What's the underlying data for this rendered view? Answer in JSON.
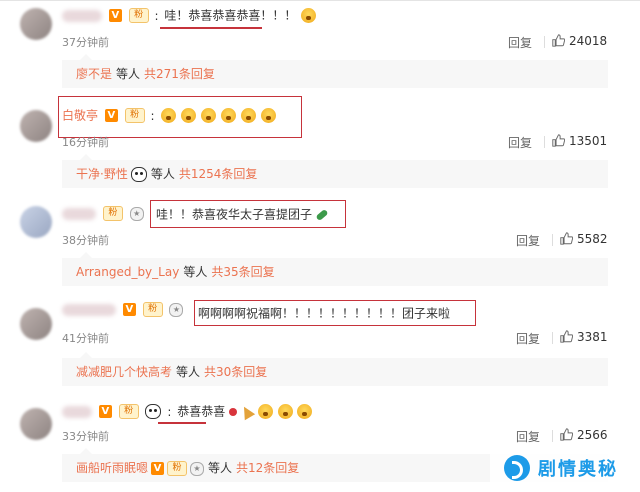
{
  "comments": [
    {
      "username": "",
      "badges": [
        "V",
        "fan"
      ],
      "text": "哇！恭喜恭喜恭喜！！！",
      "emoji_count": 1,
      "time": "37分钟前",
      "reply_label": "回复",
      "likes": "24018",
      "sub_who": "廖不是",
      "sub_etc": "等人",
      "sub_total": "共271条回复"
    },
    {
      "username": "白敬亭",
      "badges": [
        "V",
        "fan"
      ],
      "text": "",
      "emoji_count": 6,
      "time": "16分钟前",
      "reply_label": "回复",
      "likes": "13501",
      "sub_who": "干净·野性",
      "sub_etc": "等人",
      "sub_total": "共1254条回复"
    },
    {
      "username": "",
      "badges": [
        "fan",
        "medal"
      ],
      "text": "哇！！恭喜夜华太子喜提团子",
      "emoji_count": 0,
      "time": "38分钟前",
      "reply_label": "回复",
      "likes": "5582",
      "sub_who": "Arranged_by_Lay",
      "sub_etc": "等人",
      "sub_total": "共35条回复"
    },
    {
      "username": "",
      "badges": [
        "V",
        "fan",
        "medal"
      ],
      "text": "啊啊啊啊祝福啊！！！！！！！！！！团子来啦",
      "emoji_count": 0,
      "time": "41分钟前",
      "reply_label": "回复",
      "likes": "3381",
      "sub_who": "减减肥几个快高考",
      "sub_etc": "等人",
      "sub_total": "共30条回复"
    },
    {
      "username": "",
      "badges": [
        "V",
        "fan",
        "panda"
      ],
      "text": "恭喜恭喜",
      "emoji_count": 3,
      "time": "33分钟前",
      "reply_label": "回复",
      "likes": "2566",
      "sub_who": "画船听雨眠嗯",
      "sub_etc": "等人",
      "sub_total": "共12条回复"
    }
  ],
  "watermark": {
    "text": "剧情奥秘"
  },
  "colors": {
    "highlight_box": "#c6333b",
    "link": "#eb7350",
    "meta": "#888888"
  },
  "icons": [
    "v-badge-icon",
    "fan-badge-icon",
    "medal-icon",
    "panda-icon",
    "emoji-icon",
    "thumb-up-icon",
    "watermark-logo-icon"
  ]
}
